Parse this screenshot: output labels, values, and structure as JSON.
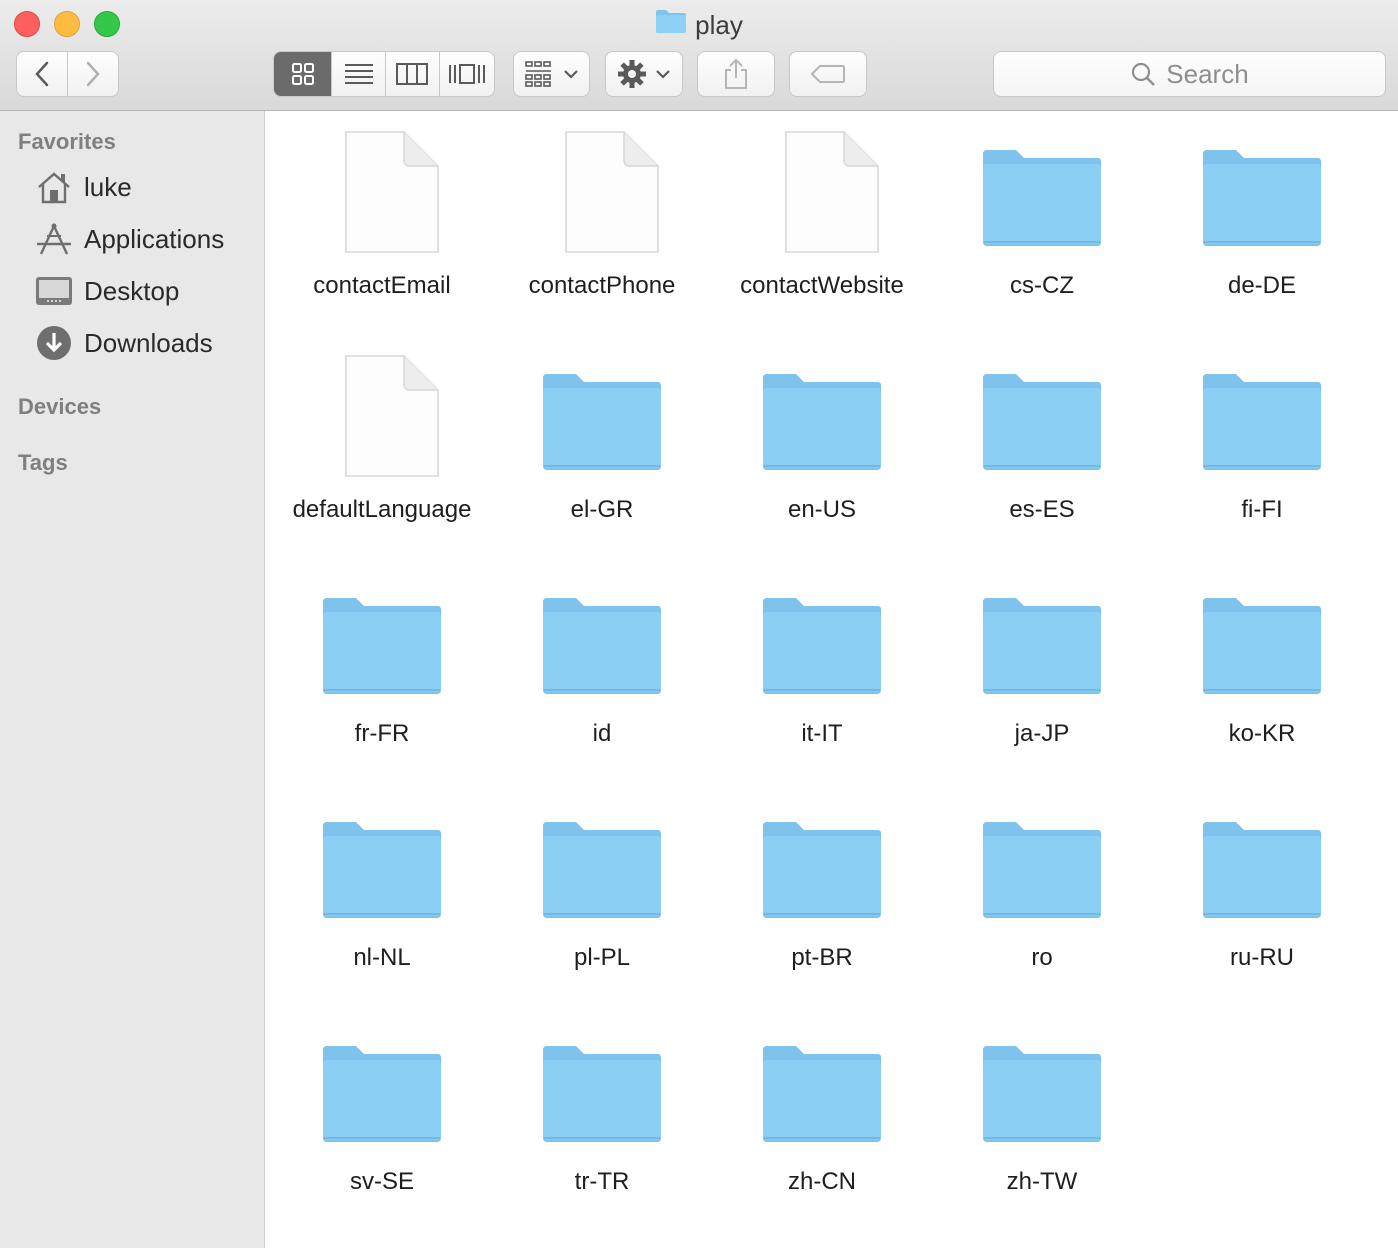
{
  "window": {
    "title": "play"
  },
  "toolbar": {
    "back_icon": "chevron-left-icon",
    "forward_icon": "chevron-right-icon",
    "view_modes": [
      "icon-view-icon",
      "list-view-icon",
      "column-view-icon",
      "cover-flow-icon"
    ],
    "active_view": 0,
    "group_icon": "arrange-grid-icon",
    "action_icon": "gear-icon",
    "share_icon": "share-icon",
    "tag_icon": "tag-icon",
    "search_placeholder": "Search"
  },
  "sidebar": {
    "favorites_header": "Favorites",
    "items": [
      {
        "label": "luke",
        "icon": "home-icon"
      },
      {
        "label": "Applications",
        "icon": "applications-icon"
      },
      {
        "label": "Desktop",
        "icon": "desktop-icon"
      },
      {
        "label": "Downloads",
        "icon": "downloads-icon"
      }
    ],
    "devices_header": "Devices",
    "tags_header": "Tags"
  },
  "files": [
    {
      "name": "contactEmail",
      "kind": "file"
    },
    {
      "name": "contactPhone",
      "kind": "file"
    },
    {
      "name": "contactWebsite",
      "kind": "file"
    },
    {
      "name": "cs-CZ",
      "kind": "folder"
    },
    {
      "name": "de-DE",
      "kind": "folder"
    },
    {
      "name": "defaultLanguage",
      "kind": "file"
    },
    {
      "name": "el-GR",
      "kind": "folder"
    },
    {
      "name": "en-US",
      "kind": "folder"
    },
    {
      "name": "es-ES",
      "kind": "folder"
    },
    {
      "name": "fi-FI",
      "kind": "folder"
    },
    {
      "name": "fr-FR",
      "kind": "folder"
    },
    {
      "name": "id",
      "kind": "folder"
    },
    {
      "name": "it-IT",
      "kind": "folder"
    },
    {
      "name": "ja-JP",
      "kind": "folder"
    },
    {
      "name": "ko-KR",
      "kind": "folder"
    },
    {
      "name": "nl-NL",
      "kind": "folder"
    },
    {
      "name": "pl-PL",
      "kind": "folder"
    },
    {
      "name": "pt-BR",
      "kind": "folder"
    },
    {
      "name": "ro",
      "kind": "folder"
    },
    {
      "name": "ru-RU",
      "kind": "folder"
    },
    {
      "name": "sv-SE",
      "kind": "folder"
    },
    {
      "name": "tr-TR",
      "kind": "folder"
    },
    {
      "name": "zh-CN",
      "kind": "folder"
    },
    {
      "name": "zh-TW",
      "kind": "folder"
    }
  ],
  "colors": {
    "folder": "#8ccff5",
    "folder_tab": "#7ec3ee",
    "close": "#fc605c",
    "minimize": "#fdbc40",
    "maximize": "#34c84a"
  }
}
